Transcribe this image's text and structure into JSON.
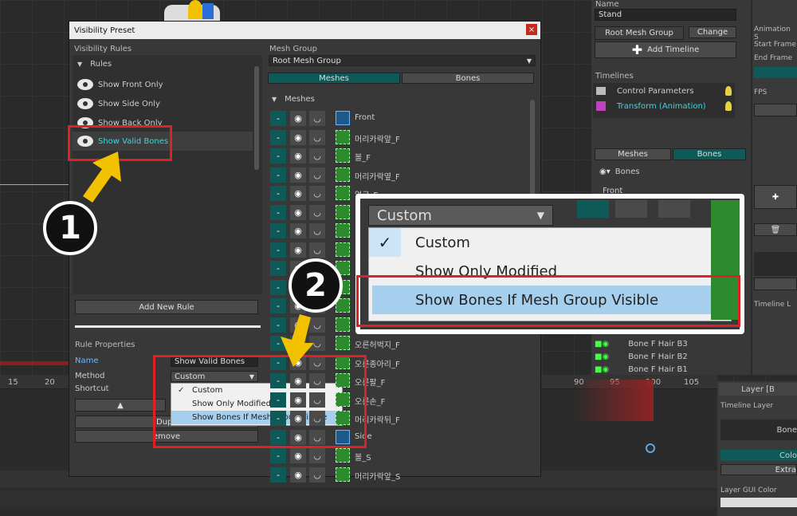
{
  "dialog": {
    "title": "Visibility Preset",
    "close_icon": "×",
    "visibility_rules_label": "Visibility Rules",
    "rules_header": "Rules",
    "rules": [
      {
        "label": "Show Front Only"
      },
      {
        "label": "Show Side Only"
      },
      {
        "label": "Show Back Only"
      },
      {
        "label": "Show Valid Bones"
      }
    ],
    "add_rule_label": "Add New Rule",
    "rule_properties_label": "Rule Properties",
    "name_label": "Name",
    "name_value": "Show Valid Bones",
    "method_label": "Method",
    "method_value": "Custom",
    "shortcut_label": "Shortcut",
    "up_arrow": "▲",
    "duplicate_label": "Dupli",
    "remove_label": "emove",
    "method_options": [
      {
        "label": "Custom",
        "checked": "✓"
      },
      {
        "label": "Show Only Modified",
        "checked": ""
      },
      {
        "label": "Show Bones If Mesh Group Visible",
        "checked": ""
      }
    ],
    "mesh_group_label": "Mesh Group",
    "mesh_group_value": "Root Mesh Group",
    "tabs": [
      "Meshes",
      "Bones"
    ],
    "meshes_header": "Meshes",
    "meshes": [
      "Front",
      "머리카락앞_F",
      "볼_F",
      "머리카락옆_F",
      "얼굴_F",
      "",
      "",
      "",
      "",
      "",
      "",
      "",
      "오른허벅지_F",
      "오른종아리_F",
      "오른팔_F",
      "오른손_F",
      "머리카락뒤_F",
      "Side",
      "볼_S",
      "머리카락앞_S"
    ]
  },
  "right_panel": {
    "name_label": "Name",
    "name_value": "Stand",
    "root_mesh_group": "Root Mesh Group",
    "change_label": "Change",
    "add_timeline_label": "Add Timeline",
    "timelines_label": "Timelines",
    "timeline_items": [
      "Control Parameters",
      "Transform (Animation)"
    ],
    "tabs": [
      "Meshes",
      "Bones"
    ],
    "bones_header": "Bones",
    "front_item": "Front",
    "bone_rows": [
      "Bone F Hair B3",
      "Bone F Hair B2",
      "Bone F Hair B1"
    ]
  },
  "far_right": {
    "animation_s": "Animation S",
    "start_frame": "Start Frame",
    "end_frame": "End Frame",
    "fps": "FPS",
    "layer_label": "Layer [B",
    "timeline_layer": "Timeline Layer",
    "bone_label": "Bone",
    "color_label": "Colo",
    "extra_label": "Extra",
    "layer_gui_color": "Layer GUI Color",
    "timeline_l": "Timeline L"
  },
  "timeline": {
    "ticks": [
      "15",
      "20",
      "90",
      "95",
      "100",
      "105"
    ]
  },
  "zoom": {
    "dropdown_value": "Custom",
    "options": [
      "Custom",
      "Show Only Modified",
      "Show Bones If Mesh Group Visible"
    ]
  },
  "annotations": {
    "step1": "1",
    "step2": "2"
  },
  "colors": {
    "teal": "#0e5a58",
    "highlight_red": "#e01f26",
    "arrow_yellow": "#f2c200",
    "menu_selected": "#a6cfee"
  }
}
